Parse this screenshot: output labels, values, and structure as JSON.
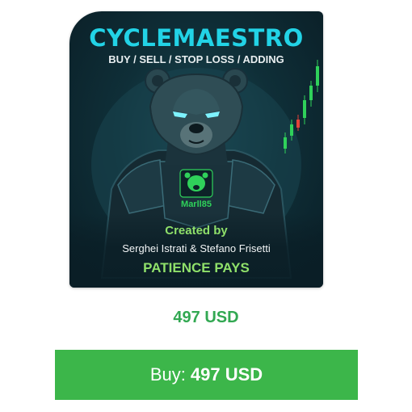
{
  "product": {
    "title": "CYCLEMAESTRO",
    "tagline": "BUY / SELL / STOP LOSS / ADDING",
    "badge_label": "Marll85",
    "created_by": "Created by",
    "authors": "Serghei Istrati & Stefano Frisetti",
    "motto": "PATIENCE PAYS",
    "art": "armored-bear-icon"
  },
  "price": {
    "label": "497 USD"
  },
  "buy_button": {
    "prefix": "Buy:",
    "amount": "497 USD"
  },
  "colors": {
    "title": "#22d3e6",
    "accent_green": "#8fe06a",
    "price_green": "#32a852",
    "button_green": "#3cb64a",
    "card_background": "#0f2f38"
  }
}
